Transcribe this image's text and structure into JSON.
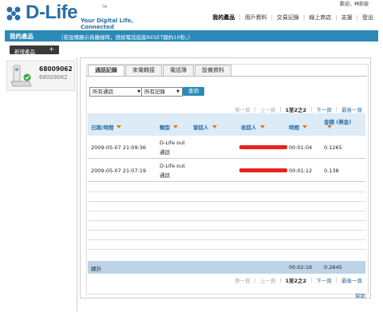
{
  "brand": {
    "name": "D-Life",
    "tm": "TM",
    "tagline": "Your Digital Life, Connected",
    "colors": {
      "blue": "#2b6ea8",
      "accent": "#2b8ab8"
    }
  },
  "welcome": "歡迎，林欽嵌",
  "topnav": [
    "我的產品",
    "用戶資料",
    "交易記錄",
    "線上商店",
    "支援",
    "登出"
  ],
  "bluebar": {
    "title": "我的產品",
    "notice": "（若設備顯示爲離線時，請按電話底座RESET鍵約10秒。）"
  },
  "add_product": {
    "label": "新增產品",
    "plus": "+"
  },
  "device": {
    "number": "68009062",
    "sub": "68009062",
    "icon": "phone-base-icon"
  },
  "tabs": [
    "通話記錄",
    "來電轉接",
    "電話簿",
    "設備資料"
  ],
  "filters": {
    "call_type": "所有通話",
    "records": "所有記錄",
    "query_label": "查詢"
  },
  "pager": {
    "first": "第一頁",
    "prev": "上一頁",
    "status": "1至2之2",
    "next": "下一頁",
    "last": "最後一頁"
  },
  "columns": {
    "datetime": "日期/時間",
    "type": "類型",
    "caller": "發話人",
    "callee": "收話人",
    "duration": "時間",
    "amount_line1": "金額 (美金)"
  },
  "rows": [
    {
      "datetime": "2009-05-07 21:09:36",
      "type_l1": "D-Life out",
      "type_l2": "通話",
      "duration": "00:01:04",
      "amount": "0.1265"
    },
    {
      "datetime": "2009-05-07 21:07:19",
      "type_l1": "D-Life out",
      "type_l2": "通話",
      "duration": "00:01:12",
      "amount": "0.138"
    }
  ],
  "total": {
    "label": "總計",
    "duration": "00:02:16",
    "amount": "0.2645"
  },
  "help": "幫助"
}
